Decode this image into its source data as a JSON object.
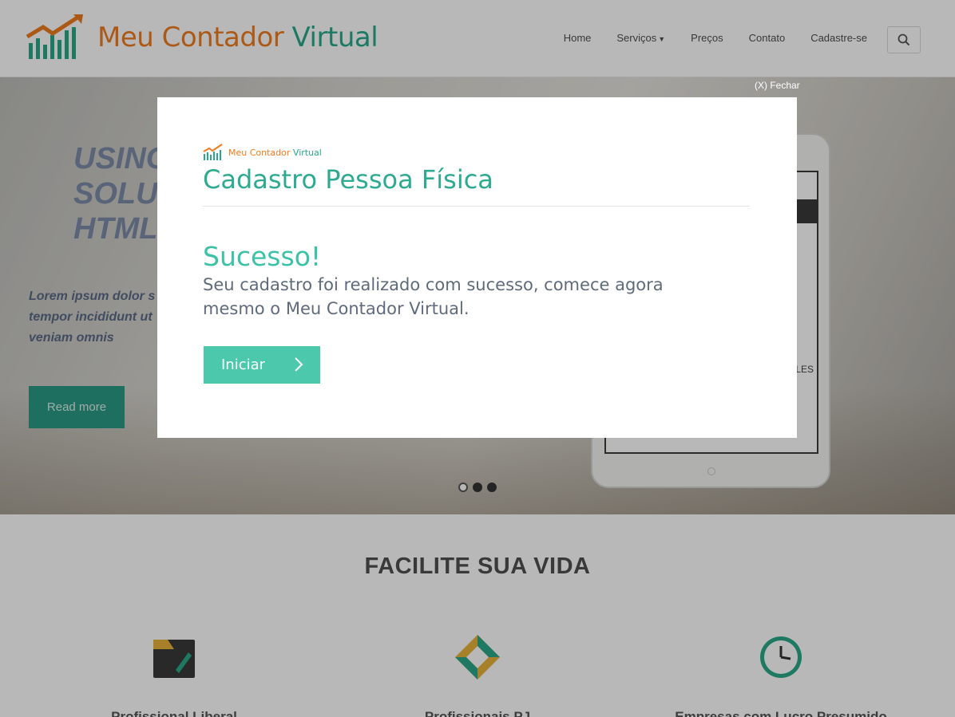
{
  "header": {
    "logo": {
      "word1": "Meu ",
      "word2": "Contador ",
      "word3": "Virtual"
    },
    "nav": [
      {
        "label": "Home"
      },
      {
        "label": "Serviços"
      },
      {
        "label": "Preços"
      },
      {
        "label": "Contato"
      },
      {
        "label": "Cadastre-se"
      }
    ]
  },
  "hero": {
    "title_lines": [
      "USING",
      "SOLU",
      "HTML"
    ],
    "text_lines": [
      "Lorem ipsum dolor s",
      "tempor incididunt ut",
      "veniam omnis"
    ],
    "read_more": "Read more",
    "tablet_text": "LES",
    "slides": 3,
    "active_slide": 0
  },
  "features": {
    "title": "FACILITE SUA VIDA",
    "items": [
      {
        "title": "Profissional Liberal",
        "icon": "pencil-folder-icon"
      },
      {
        "title": "Profissionais PJ",
        "icon": "diamond-icon"
      },
      {
        "title": "Empresas com Lucro Presumido",
        "icon": "clock-icon"
      }
    ]
  },
  "modal": {
    "close_label": "(X) Fechar",
    "logo": {
      "word1": "Meu ",
      "word2": "Contador ",
      "word3": "Virtual"
    },
    "title": "Cadastro Pessoa Física",
    "success_heading": "Sucesso!",
    "message": "Seu cadastro foi realizado com sucesso, comece agora mesmo o Meu Contador Virtual.",
    "button_label": "Iniciar"
  },
  "colors": {
    "brand_orange": "#f07c1f",
    "brand_green": "#28a889",
    "accent_teal": "#4cc9ac"
  }
}
